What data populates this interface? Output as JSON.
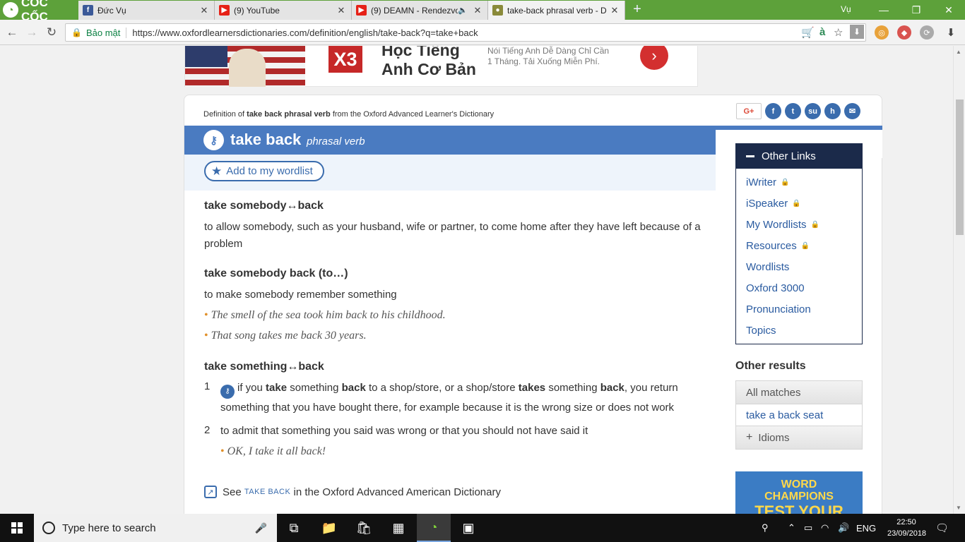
{
  "browser": {
    "brand": "CỐC CỐC",
    "tabs": [
      {
        "title": "Đức Vụ",
        "favicon": "facebook-icon",
        "color": "#3b5998"
      },
      {
        "title": "(9) YouTube",
        "favicon": "youtube-icon",
        "color": "#e62117"
      },
      {
        "title": "(9) DEAMN - Rendezvo",
        "favicon": "youtube-icon",
        "color": "#e62117"
      },
      {
        "title": "take-back phrasal verb - D",
        "favicon": "oxford-icon",
        "color": "#8a8a3a"
      }
    ],
    "profile_name": "Vụ",
    "security_label": "Bảo mật",
    "url": "https://www.oxfordlearnersdictionaries.com/definition/english/take-back?q=take+back",
    "omnibox_letter": "à"
  },
  "ad": {
    "badge": "X3",
    "title": "Học Tiếng Anh Cơ Bản",
    "description": "Nói Tiếng Anh Dễ Dàng Chỉ Cần 1 Tháng. Tải Xuống Miễn Phí."
  },
  "entry": {
    "definition_prefix": "Definition of ",
    "definition_term": "take back phrasal verb",
    "definition_suffix": " from the Oxford Advanced Learner's Dictionary",
    "headword": "take back",
    "part_of_speech": "phrasal verb",
    "wordlist_label": "Add to my wordlist",
    "share_google": "G+",
    "senses": [
      {
        "phrase": "take somebody↔back",
        "definition": "to allow somebody, such as your husband, wife or partner, to come home after they have left because of a problem"
      },
      {
        "phrase": "take somebody back (to…)",
        "definition": "to make somebody remember something",
        "examples": [
          "The smell of the sea took him back to his childhood.",
          "That song takes me back 30 years."
        ]
      }
    ],
    "sense3_phrase": "take something↔back",
    "sub1_number": "1",
    "sub1_a": "if you ",
    "sub1_b": "take",
    "sub1_c": " something ",
    "sub1_d": "back",
    "sub1_e": " to a shop/store, or a shop/store ",
    "sub1_f": "takes",
    "sub1_g": " something ",
    "sub1_h": "back",
    "sub1_i": ", you return something that you have bought there, for example because it is the wrong size or does not work",
    "sub2_number": "2",
    "sub2_definition": "to admit that something you said was wrong or that you should not have said it",
    "sub2_example": "OK, I take it all back!",
    "see_prefix": "See ",
    "see_term": "TAKE BACK",
    "see_suffix": " in the Oxford Advanced American Dictionary"
  },
  "sidebar": {
    "other_links_title": "Other Links",
    "links": [
      {
        "label": "iWriter",
        "locked": true
      },
      {
        "label": "iSpeaker",
        "locked": true
      },
      {
        "label": "My Wordlists",
        "locked": true
      },
      {
        "label": "Resources",
        "locked": true
      },
      {
        "label": "Wordlists",
        "locked": false
      },
      {
        "label": "Oxford 3000",
        "locked": false
      },
      {
        "label": "Pronunciation",
        "locked": false
      },
      {
        "label": "Topics",
        "locked": false
      }
    ],
    "other_results_title": "Other results",
    "all_matches": "All matches",
    "result_link": "take a back seat",
    "idioms": "Idioms",
    "banner_line1": "WORD",
    "banner_line2": "CHAMPIONS",
    "banner_line3": "TEST YOUR"
  },
  "taskbar": {
    "search_placeholder": "Type here to search",
    "language": "ENG",
    "time": "22:50",
    "date": "23/09/2018"
  },
  "colors": {
    "accent_blue": "#4a7bc1",
    "sidebar_navy": "#1b2a4a",
    "browser_green": "#5da13a"
  }
}
